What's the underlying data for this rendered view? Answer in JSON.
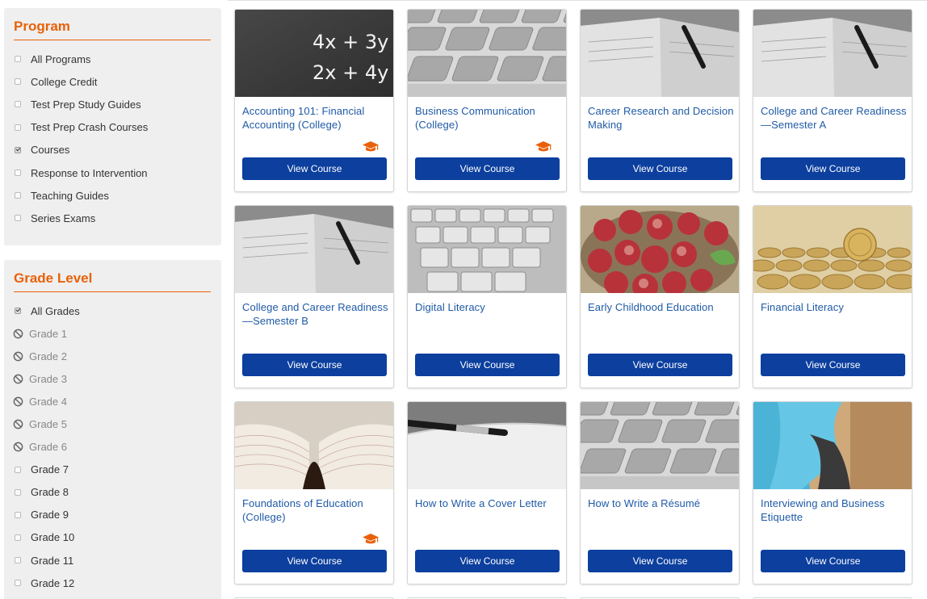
{
  "program": {
    "title": "Program",
    "items": [
      {
        "label": "All Programs",
        "checked": false
      },
      {
        "label": "College Credit",
        "checked": false
      },
      {
        "label": "Test Prep Study Guides",
        "checked": false
      },
      {
        "label": "Test Prep Crash Courses",
        "checked": false
      },
      {
        "label": "Courses",
        "checked": true
      },
      {
        "label": "Response to Intervention",
        "checked": false
      },
      {
        "label": "Teaching Guides",
        "checked": false
      },
      {
        "label": "Series Exams",
        "checked": false
      }
    ]
  },
  "grade": {
    "title": "Grade Level",
    "items": [
      {
        "label": "All Grades",
        "state": "checked"
      },
      {
        "label": "Grade 1",
        "state": "disabled"
      },
      {
        "label": "Grade 2",
        "state": "disabled"
      },
      {
        "label": "Grade 3",
        "state": "disabled"
      },
      {
        "label": "Grade 4",
        "state": "disabled"
      },
      {
        "label": "Grade 5",
        "state": "disabled"
      },
      {
        "label": "Grade 6",
        "state": "disabled"
      },
      {
        "label": "Grade 7",
        "state": "unchecked"
      },
      {
        "label": "Grade 8",
        "state": "unchecked"
      },
      {
        "label": "Grade 9",
        "state": "unchecked"
      },
      {
        "label": "Grade 10",
        "state": "unchecked"
      },
      {
        "label": "Grade 11",
        "state": "unchecked"
      },
      {
        "label": "Grade 12",
        "state": "unchecked"
      }
    ]
  },
  "courses": [
    {
      "title": "Accounting 101: Financial Accounting (College)",
      "image": "chalkboard-equations",
      "college_credit": true,
      "button": "View Course"
    },
    {
      "title": "Business Communication (College)",
      "image": "keyboard",
      "college_credit": true,
      "button": "View Course"
    },
    {
      "title": "Career Research and Decision Making",
      "image": "notebook-pen",
      "college_credit": false,
      "button": "View Course"
    },
    {
      "title": "College and Career Readiness—Semester A",
      "image": "notebook-pen",
      "college_credit": false,
      "button": "View Course"
    },
    {
      "title": "College and Career Readiness—Semester B",
      "image": "notebook-pen",
      "college_credit": false,
      "button": "View Course"
    },
    {
      "title": "Digital Literacy",
      "image": "keyboard-close",
      "college_credit": false,
      "button": "View Course"
    },
    {
      "title": "Early Childhood Education",
      "image": "apples-bowl",
      "college_credit": false,
      "button": "View Course"
    },
    {
      "title": "Financial Literacy",
      "image": "coins",
      "college_credit": false,
      "button": "View Course"
    },
    {
      "title": "Foundations of Education (College)",
      "image": "open-book",
      "college_credit": true,
      "button": "View Course"
    },
    {
      "title": "How to Write a Cover Letter",
      "image": "pen-paper",
      "college_credit": false,
      "button": "View Course"
    },
    {
      "title": "How to Write a Résumé",
      "image": "keyboard",
      "college_credit": false,
      "button": "View Course"
    },
    {
      "title": "Interviewing and Business Etiquette",
      "image": "blue-shirt",
      "college_credit": false,
      "button": "View Course"
    }
  ],
  "colors": {
    "accent": "#e8610a",
    "button": "#0c3f9e",
    "link": "#1f5aa6",
    "sidebar_bg": "#efefef"
  }
}
